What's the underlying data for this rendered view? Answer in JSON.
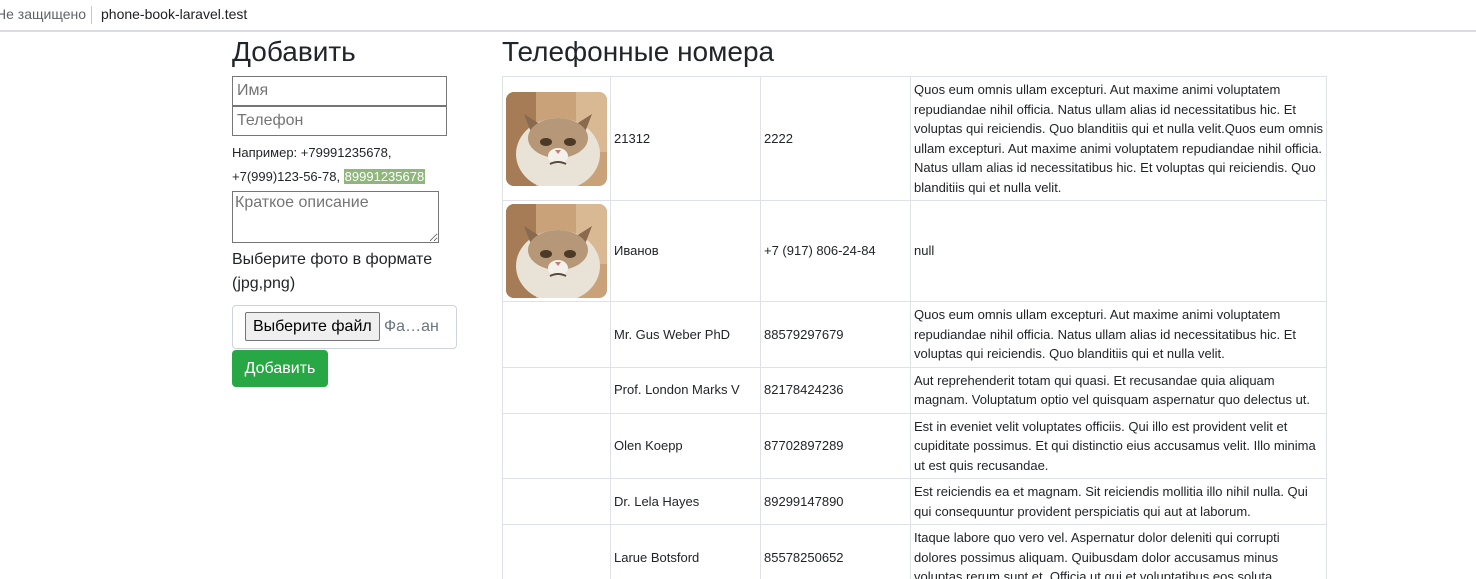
{
  "browser": {
    "security": "Не защищено",
    "url": "phone-book-laravel.test"
  },
  "form": {
    "title": "Добавить",
    "name_placeholder": "Имя",
    "phone_placeholder": "Телефон",
    "hint_text": "Например: +79991235678, +7(999)123-56-78, ",
    "hint_highlight": "89991235678",
    "description_placeholder": "Краткое описание",
    "photo_label": "Выберите фото в формате (jpg,png)",
    "file_button": "Выберите файл",
    "file_name": "Фа…ан",
    "submit": "Добавить"
  },
  "phonebook": {
    "title": "Телефонные номера",
    "rows": [
      {
        "has_photo": true,
        "name": "21312",
        "phone": "2222",
        "description": "Quos eum omnis ullam excepturi. Aut maxime animi voluptatem repudiandae nihil officia. Natus ullam alias id necessitatibus hic. Et voluptas qui reiciendis. Quo blanditiis qui et nulla velit.Quos eum omnis ullam excepturi. Aut maxime animi voluptatem repudiandae nihil officia. Natus ullam alias id necessitatibus hic. Et voluptas qui reiciendis. Quo blanditiis qui et nulla velit."
      },
      {
        "has_photo": true,
        "name": "Иванов",
        "phone": "+7 (917) 806-24-84",
        "description": "null"
      },
      {
        "has_photo": false,
        "name": "Mr. Gus Weber PhD",
        "phone": "88579297679",
        "description": "Quos eum omnis ullam excepturi. Aut maxime animi voluptatem repudiandae nihil officia. Natus ullam alias id necessitatibus hic. Et voluptas qui reiciendis. Quo blanditiis qui et nulla velit."
      },
      {
        "has_photo": false,
        "name": "Prof. London Marks V",
        "phone": "82178424236",
        "description": "Aut reprehenderit totam qui quasi. Et recusandae quia aliquam magnam. Voluptatum optio vel quisquam aspernatur quo delectus ut."
      },
      {
        "has_photo": false,
        "name": "Olen Koepp",
        "phone": "87702897289",
        "description": "Est in eveniet velit voluptates officiis. Qui illo est provident velit et cupiditate possimus. Et qui distinctio eius accusamus velit. Illo minima ut est quis recusandae."
      },
      {
        "has_photo": false,
        "name": "Dr. Lela Hayes",
        "phone": "89299147890",
        "description": "Est reiciendis ea et magnam. Sit reiciendis mollitia illo nihil nulla. Qui qui consequuntur provident perspiciatis qui aut at laborum."
      },
      {
        "has_photo": false,
        "name": "Larue Botsford",
        "phone": "85578250652",
        "description": "Itaque labore quo vero vel. Aspernatur dolor deleniti qui corrupti dolores possimus aliquam. Quibusdam dolor accusamus minus voluptas rerum sunt et. Officia ut qui et voluptatibus eos soluta."
      }
    ]
  }
}
